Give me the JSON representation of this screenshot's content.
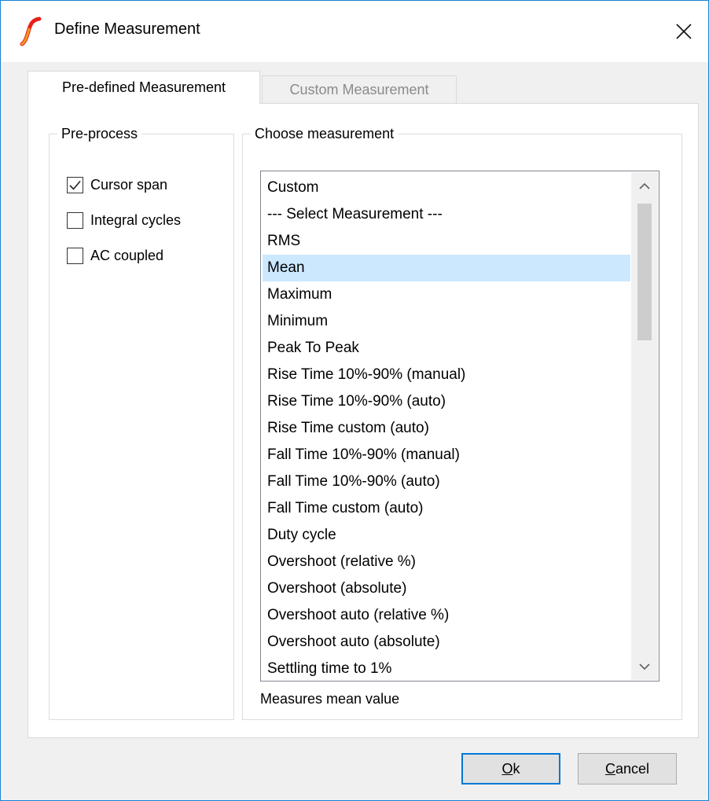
{
  "window": {
    "title": "Define Measurement",
    "accent_color": "#1883d7",
    "app_icon": "simetrix-logo-icon",
    "close_icon": "close-icon"
  },
  "tabs": [
    {
      "label": "Pre-defined Measurement",
      "active": true
    },
    {
      "label": "Custom Measurement",
      "active": false
    }
  ],
  "preprocess": {
    "legend": "Pre-process",
    "options": [
      {
        "label": "Cursor span",
        "checked": true
      },
      {
        "label": "Integral cycles",
        "checked": false
      },
      {
        "label": "AC coupled",
        "checked": false
      }
    ]
  },
  "choose": {
    "legend": "Choose measurement",
    "selected_index": 3,
    "selection_color": "#cce8ff",
    "items": [
      "Custom",
      "--- Select Measurement ---",
      "RMS",
      "Mean",
      "Maximum",
      "Minimum",
      "Peak To Peak",
      "Rise Time 10%-90% (manual)",
      "Rise Time 10%-90% (auto)",
      "Rise Time custom (auto)",
      "Fall Time 10%-90% (manual)",
      "Fall Time 10%-90% (auto)",
      "Fall Time custom (auto)",
      "Duty cycle",
      "Overshoot (relative %)",
      "Overshoot (absolute)",
      "Overshoot auto (relative %)",
      "Overshoot auto (absolute)",
      "Settling time to 1%"
    ],
    "description": "Measures mean value"
  },
  "buttons": {
    "ok": {
      "mnemonic": "O",
      "rest": "k"
    },
    "cancel": {
      "mnemonic": "C",
      "rest": "ancel"
    }
  }
}
